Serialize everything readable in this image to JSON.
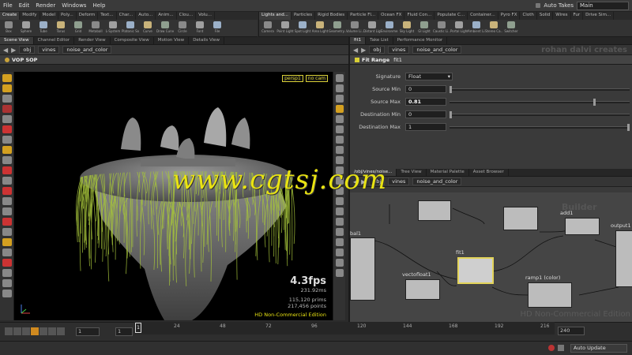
{
  "menubar": {
    "items": [
      "File",
      "Edit",
      "Render",
      "Windows",
      "Help"
    ],
    "auto_takes": "Auto Takes",
    "desktop": "Main"
  },
  "shelf_left": {
    "tabs": [
      "Create",
      "Modify",
      "Model",
      "Poly...",
      "Deform",
      "Text...",
      "Char...",
      "Auto...",
      "Anim...",
      "Clou...",
      "Volu..."
    ],
    "tools": [
      "Box",
      "Sphere",
      "Tube",
      "Torus",
      "Grid",
      "Metaball",
      "L-System",
      "Platonic So...",
      "Curve",
      "Draw Curve",
      "Circle",
      "Font",
      "File"
    ]
  },
  "shelf_right": {
    "tabs": [
      "Lights and...",
      "Particles",
      "Rigid Bodies",
      "Particle Fl...",
      "Ocean FX",
      "Fluid Con...",
      "Populate C...",
      "Container...",
      "Pyro FX",
      "Cloth",
      "Solid",
      "Wires",
      "Fur",
      "Drive Sim..."
    ],
    "tools": [
      "Camera",
      "Point Light",
      "Spot Light",
      "Area Light",
      "Geometry...",
      "Volume Li...",
      "Distant Light",
      "Environme...",
      "Sky Light",
      "GI Light",
      "Caustic Li...",
      "Portal Light",
      "Ambient Li...",
      "Stereo Ca...",
      "Switcher"
    ]
  },
  "left_pane": {
    "tabs": [
      "Scene View",
      "Channel Editor",
      "Render View",
      "Composite View",
      "Motion View",
      "Details View"
    ],
    "path": [
      "obj",
      "vines",
      "noise_and_color"
    ],
    "title": "VOP SOP",
    "camera": "persp1",
    "cam_mode": "no cam",
    "fps": "4.3fps",
    "ms": "231.92ms",
    "prims": "115,120  prims",
    "points": "217,456  points",
    "edition": "HD Non-Commercial Edition"
  },
  "param_pane": {
    "tabs": [
      "fit1",
      "Take List",
      "Performance Monitor"
    ],
    "path": [
      "obj",
      "vines",
      "noise_and_color"
    ],
    "node_type": "Fit Range",
    "node_name": "fit1",
    "signature_label": "Signature",
    "signature_value": "Float",
    "params": [
      {
        "label": "Source Min",
        "value": "0",
        "knob": 0.0,
        "bold": false
      },
      {
        "label": "Source Max",
        "value": "0.81",
        "knob": 0.81,
        "bold": true
      },
      {
        "label": "Destination Min",
        "value": "0",
        "knob": 0.0,
        "bold": false
      },
      {
        "label": "Destination Max",
        "value": "1",
        "knob": 1.0,
        "bold": false
      }
    ],
    "credit": "rohan dalvi creates"
  },
  "network_pane": {
    "tabs": [
      "/obj/vines/noise...",
      "Tree View",
      "Material Palette",
      "Asset Browser"
    ],
    "path": [
      "obj",
      "vines",
      "noise_and_color"
    ],
    "nodes": {
      "add1": "add1",
      "output1": "output1",
      "fit1": "fit1",
      "vectofloat1": "vectofloat1",
      "ramp1": "ramp1  (color)",
      "global1": "bal1"
    },
    "watermark": "HD Non-Commercial Edition",
    "builder": "Builder"
  },
  "timeline": {
    "start": "1",
    "current": "1",
    "frame_marker": "1",
    "ticks": [
      "24",
      "48",
      "72",
      "96",
      "120",
      "144",
      "168",
      "192",
      "216"
    ],
    "end": "240",
    "auto_update": "Auto Update"
  },
  "overlay": {
    "watermark": "www.cgtsj.com"
  },
  "colors": {
    "accent": "#e9e312",
    "grass": "#a6c43b",
    "node_selected": "#e3d45a"
  }
}
